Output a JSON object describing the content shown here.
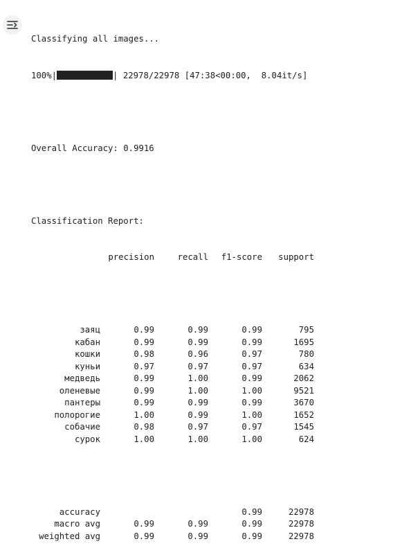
{
  "progress": {
    "title": "Classifying all images...",
    "percent": "100%",
    "fraction_complete": 1.0,
    "count": "22978/22978",
    "timing": "[47:38<00:00,  8.04it/s]"
  },
  "accuracy_line": "Overall Accuracy: 0.9916",
  "report": {
    "title": "Classification Report:",
    "headers": [
      "precision",
      "recall",
      "f1-score",
      "support"
    ],
    "rows": [
      {
        "label": "заяц",
        "precision": "0.99",
        "recall": "0.99",
        "f1": "0.99",
        "support": "795"
      },
      {
        "label": "кабан",
        "precision": "0.99",
        "recall": "0.99",
        "f1": "0.99",
        "support": "1695"
      },
      {
        "label": "кошки",
        "precision": "0.98",
        "recall": "0.96",
        "f1": "0.97",
        "support": "780"
      },
      {
        "label": "куньи",
        "precision": "0.97",
        "recall": "0.97",
        "f1": "0.97",
        "support": "634"
      },
      {
        "label": "медведь",
        "precision": "0.99",
        "recall": "1.00",
        "f1": "0.99",
        "support": "2062"
      },
      {
        "label": "оленевые",
        "precision": "0.99",
        "recall": "1.00",
        "f1": "1.00",
        "support": "9521"
      },
      {
        "label": "пантеры",
        "precision": "0.99",
        "recall": "0.99",
        "f1": "0.99",
        "support": "3670"
      },
      {
        "label": "полорогие",
        "precision": "1.00",
        "recall": "0.99",
        "f1": "1.00",
        "support": "1652"
      },
      {
        "label": "собачие",
        "precision": "0.98",
        "recall": "0.97",
        "f1": "0.97",
        "support": "1545"
      },
      {
        "label": "сурок",
        "precision": "1.00",
        "recall": "1.00",
        "f1": "1.00",
        "support": "624"
      }
    ],
    "summary": [
      {
        "label": "accuracy",
        "precision": "",
        "recall": "",
        "f1": "0.99",
        "support": "22978"
      },
      {
        "label": "macro avg",
        "precision": "0.99",
        "recall": "0.99",
        "f1": "0.99",
        "support": "22978"
      },
      {
        "label": "weighted avg",
        "precision": "0.99",
        "recall": "0.99",
        "f1": "0.99",
        "support": "22978"
      }
    ]
  },
  "icons": {
    "output_toggle": "output-collapse-icon"
  },
  "colors": {
    "text": "#212121",
    "progress_fill": "#222222",
    "button_bg": "#f1f3f4",
    "icon": "#444746"
  }
}
